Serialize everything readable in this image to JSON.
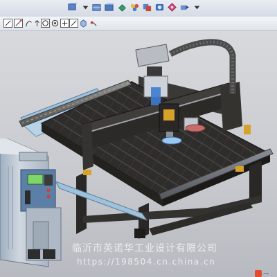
{
  "toolbar_top": {
    "items": [
      {
        "name": "view-cube-icon"
      },
      {
        "name": "shade-mode-icon"
      },
      {
        "name": "wireframe-icon"
      },
      {
        "name": "hidden-edge-icon"
      },
      {
        "name": "section-view-icon"
      },
      {
        "name": "assembly-icon"
      },
      {
        "name": "color-palette-icon"
      },
      {
        "name": "material-icon"
      },
      {
        "name": "settings-icon"
      },
      {
        "name": "render-icon"
      },
      {
        "name": "dropdown-icon"
      }
    ]
  },
  "toolbar_snap": {
    "items": [
      {
        "name": "line-snap-icon"
      },
      {
        "name": "end-point-snap-icon"
      },
      {
        "name": "curve-snap-icon"
      },
      {
        "name": "arrow-snap-icon"
      },
      {
        "name": "center-snap-icon"
      },
      {
        "name": "quadrant-snap-icon"
      },
      {
        "name": "plus-snap-icon"
      },
      {
        "name": "slash-snap-icon"
      },
      {
        "name": "box-snap-icon"
      },
      {
        "name": "point-snap-icon"
      }
    ]
  },
  "watermark": {
    "company": "临沂市英诺华工业设计有限公司",
    "url": "https://198504.cn.china.cn"
  },
  "colors": {
    "table_top": "#2f2d2b",
    "frame": "#3a3836",
    "cabinet": "#c7ced6",
    "cabinet_panel": "#5b7fa6",
    "accent_yellow": "#d6a22a",
    "cable_chain": "#4a4a4a"
  }
}
